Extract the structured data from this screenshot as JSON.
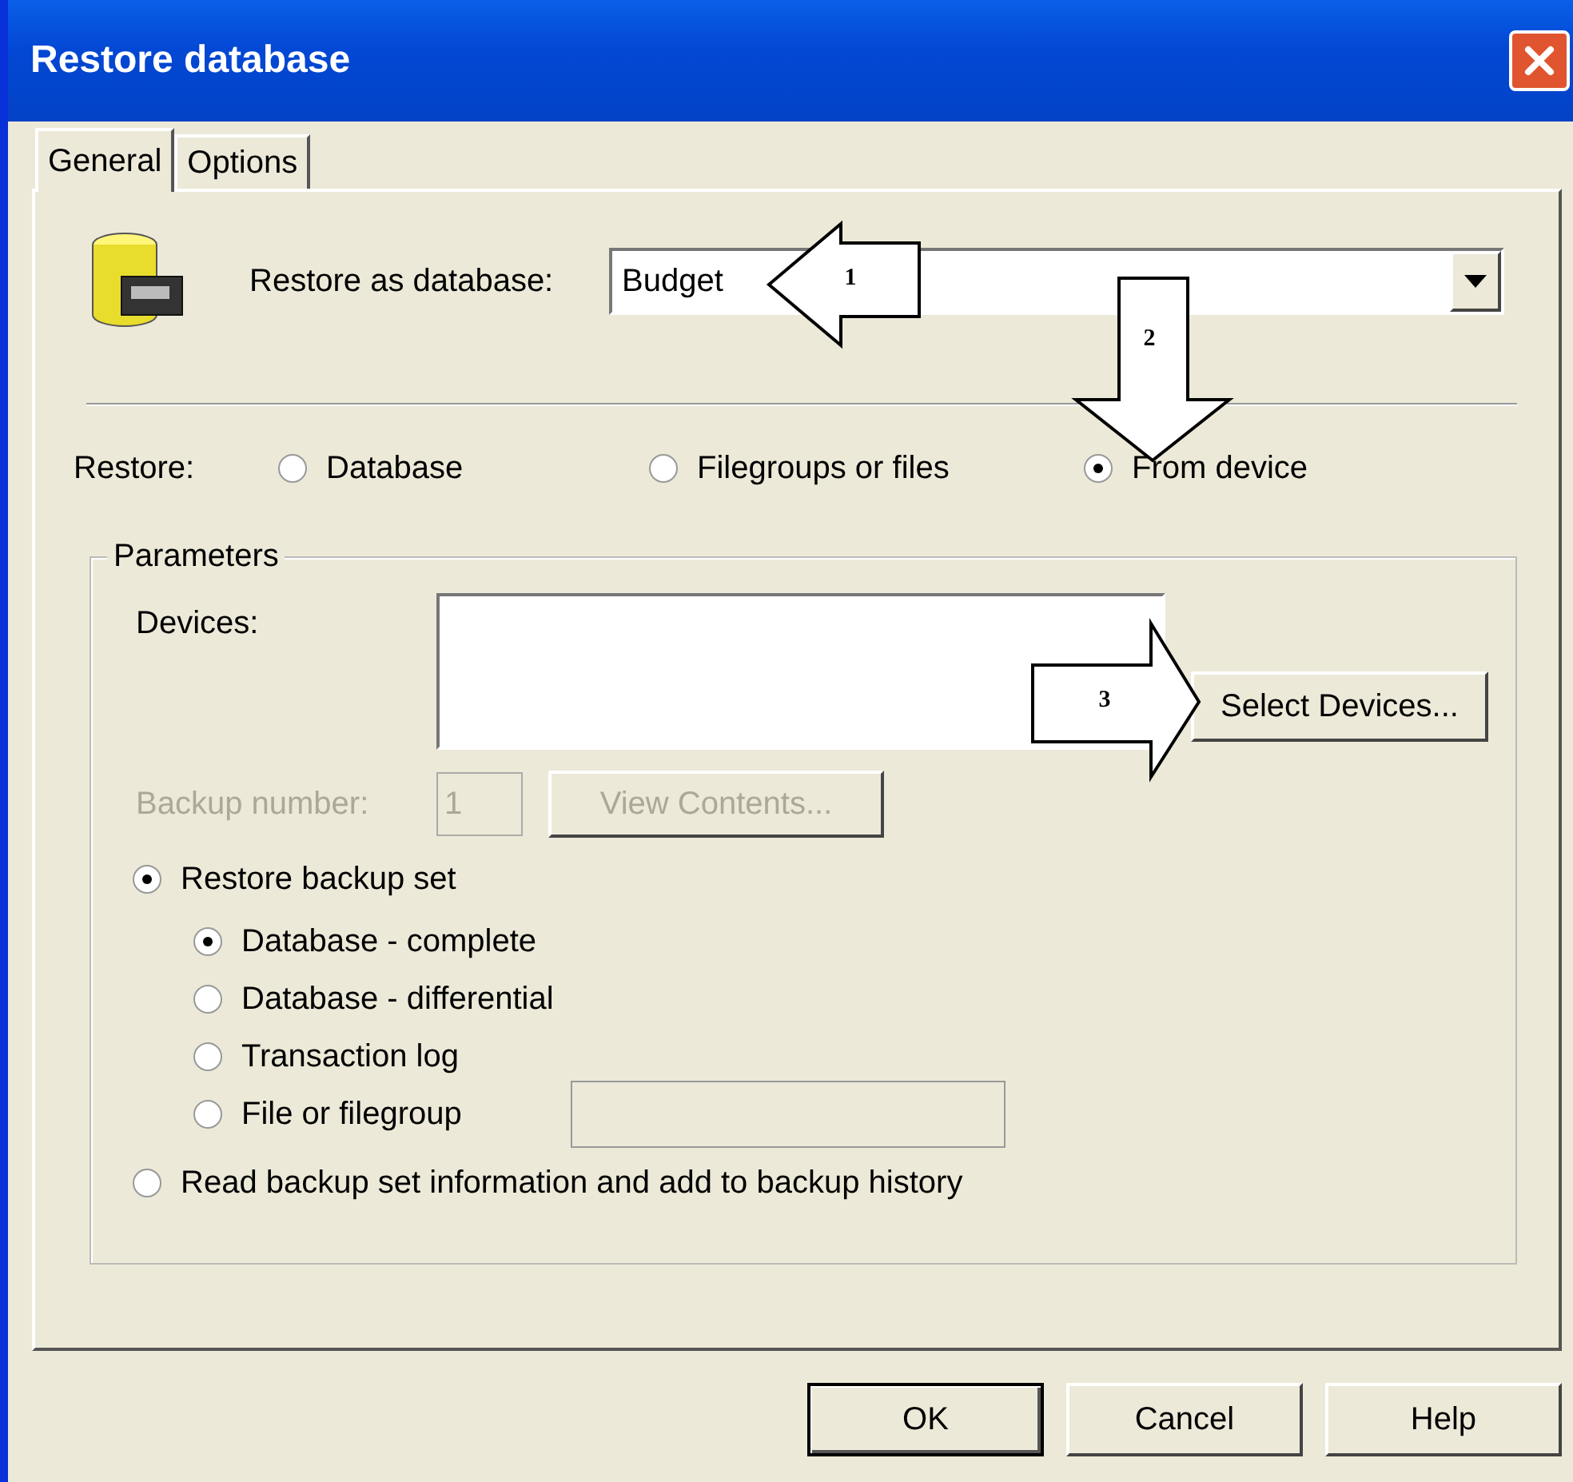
{
  "window": {
    "title": "Restore database"
  },
  "tabs": [
    {
      "label": "General",
      "selected": true
    },
    {
      "label": "Options",
      "selected": false
    }
  ],
  "restore_as": {
    "label": "Restore as database:",
    "value": "Budget"
  },
  "restore": {
    "label": "Restore:",
    "options": [
      {
        "label": "Database",
        "selected": false
      },
      {
        "label": "Filegroups or files",
        "selected": false
      },
      {
        "label": "From device",
        "selected": true
      }
    ]
  },
  "parameters": {
    "title": "Parameters",
    "devices_label": "Devices:",
    "select_button": "Select Devices...",
    "backup_number": {
      "label": "Backup number:",
      "value": "1",
      "disabled": true
    },
    "view_contents": {
      "label": "View Contents...",
      "disabled": true
    },
    "modes": [
      {
        "label": "Restore backup set",
        "selected": true,
        "options": [
          {
            "label": "Database - complete",
            "selected": true,
            "kind": "plain"
          },
          {
            "label": "Database - differential",
            "selected": false,
            "kind": "plain"
          },
          {
            "label": "Transaction log",
            "selected": false,
            "kind": "plain"
          },
          {
            "label": "File or filegroup",
            "selected": false,
            "kind": "with-field"
          }
        ]
      },
      {
        "label": "Read backup set information and add to backup history",
        "selected": false
      }
    ]
  },
  "buttons": [
    {
      "label": "OK",
      "default": true
    },
    {
      "label": "Cancel",
      "default": false
    },
    {
      "label": "Help",
      "default": false
    }
  ],
  "callouts": [
    {
      "label": "1",
      "kind": "left"
    },
    {
      "label": "2",
      "kind": "down"
    },
    {
      "label": "3",
      "kind": "right"
    }
  ]
}
